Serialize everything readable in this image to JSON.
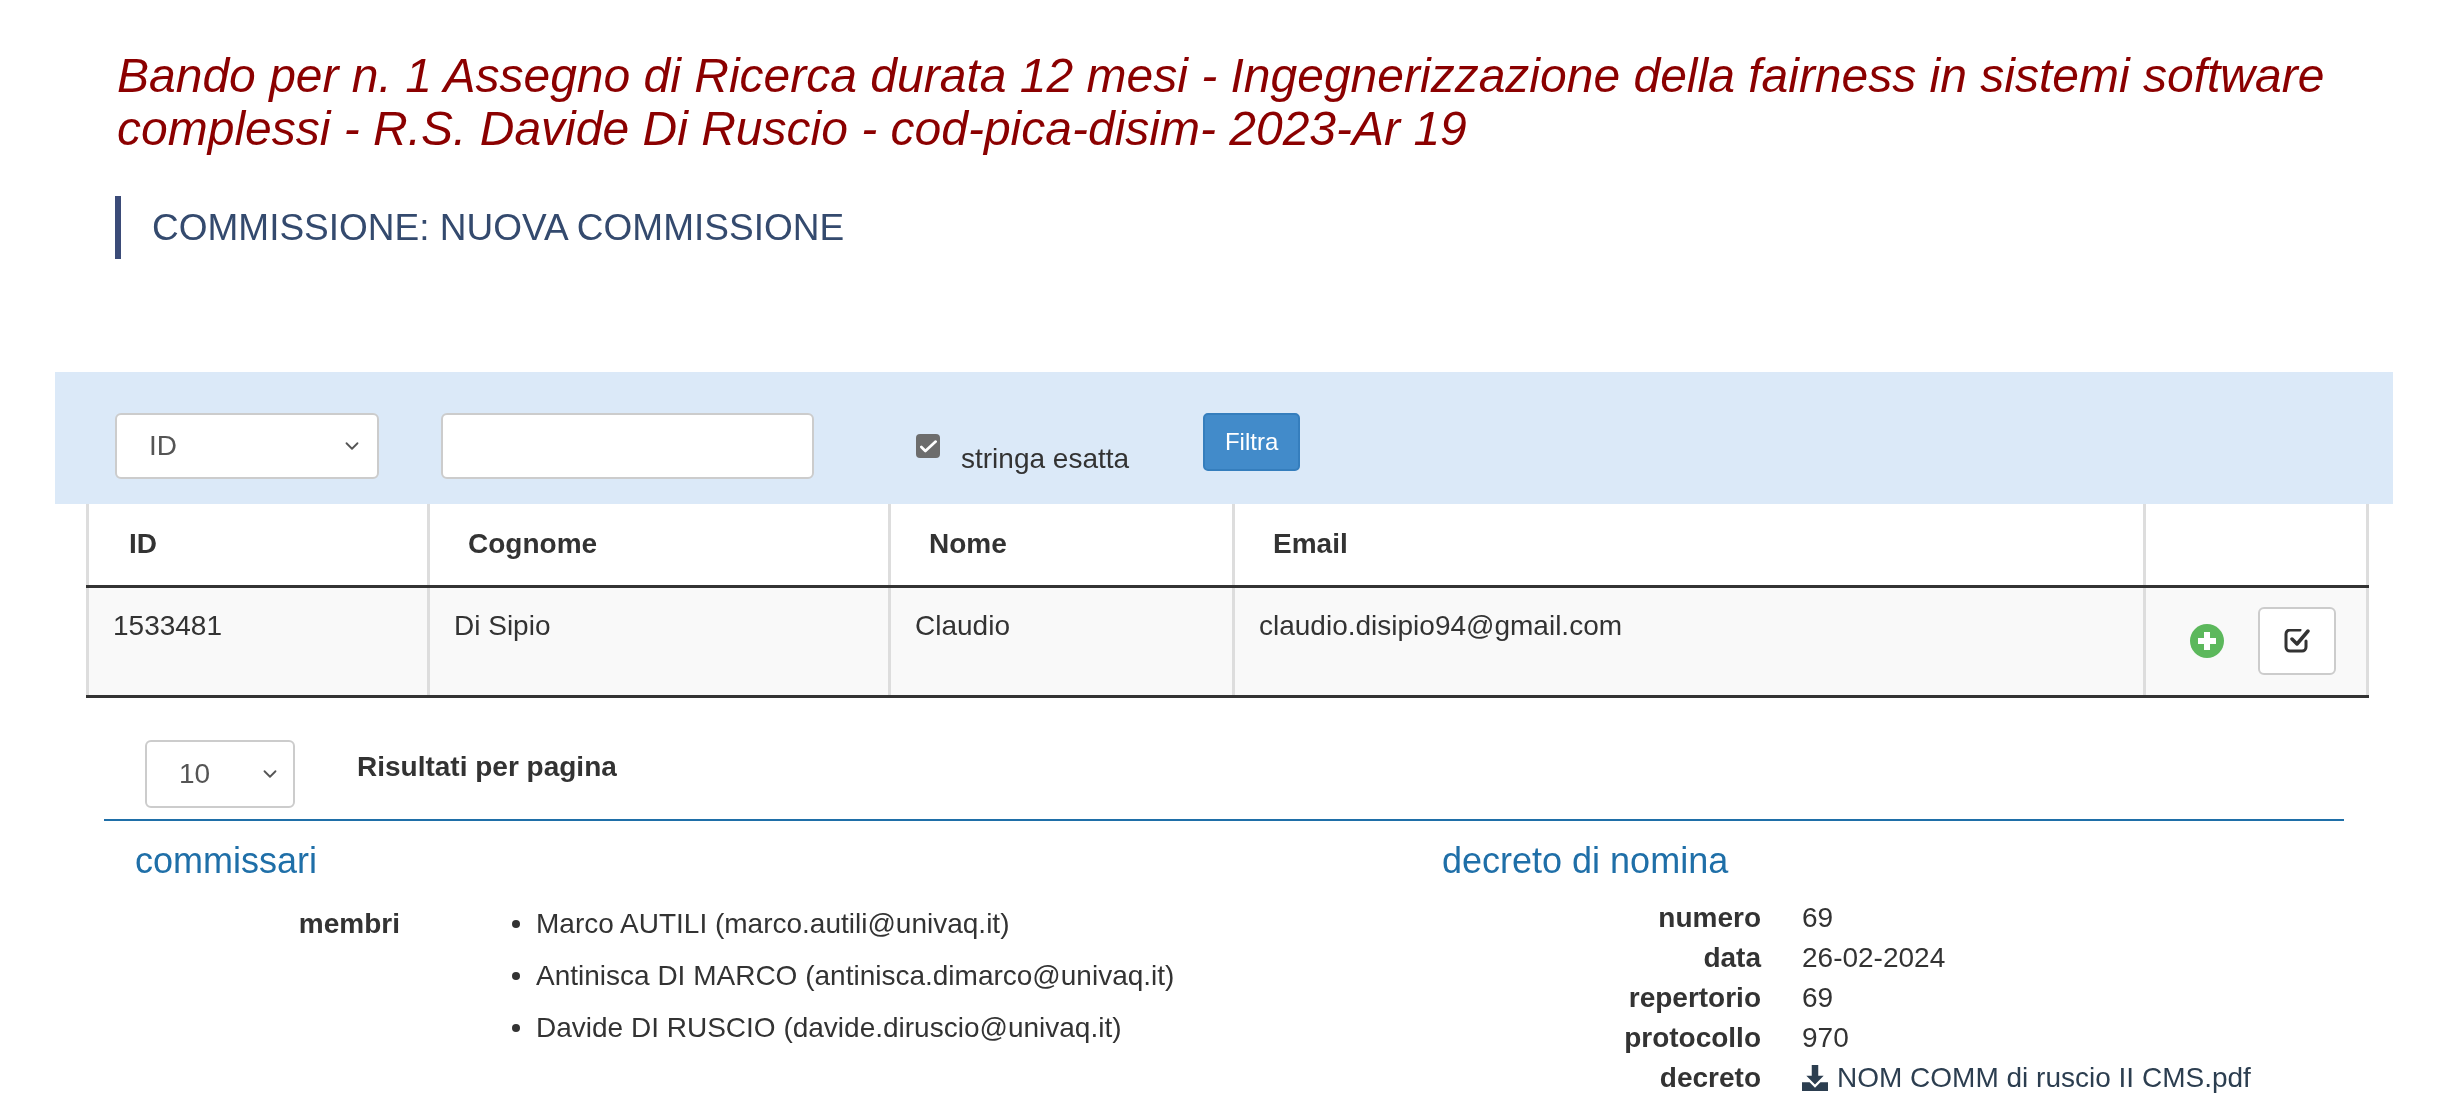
{
  "page_title": "Bando per n. 1 Assegno di Ricerca durata 12 mesi - Ingegnerizzazione della fairness in sistemi software complessi - R.S. Davide Di Ruscio - cod-pica-disim- 2023-Ar 19",
  "section_heading": "COMMISSIONE: NUOVA COMMISSIONE",
  "filter": {
    "field_select": "ID",
    "exact_match": {
      "label": "stringa esatta",
      "checked": true
    },
    "button": "Filtra"
  },
  "table": {
    "columns": [
      "ID",
      "Cognome",
      "Nome",
      "Email"
    ],
    "rows": [
      {
        "cells": [
          "1533481",
          "Di Sipio",
          "Claudio",
          "claudio.disipio94@gmail.com"
        ]
      }
    ]
  },
  "page_size": {
    "value": "10",
    "label": "Risultati per pagina"
  },
  "commissari": {
    "title": "commissari",
    "label": "membri",
    "members": [
      "Marco AUTILI (marco.autili@univaq.it)",
      "Antinisca DI MARCO (antinisca.dimarco@univaq.it)",
      "Davide DI RUSCIO (davide.diruscio@univaq.it)"
    ]
  },
  "decreto": {
    "title": "decreto di nomina",
    "fields": [
      {
        "kind": "text",
        "label": "numero",
        "value": "69"
      },
      {
        "kind": "text",
        "label": "data",
        "value": "26-02-2024"
      },
      {
        "kind": "text",
        "label": "repertorio",
        "value": "69"
      },
      {
        "kind": "text",
        "label": "protocollo",
        "value": "970"
      },
      {
        "kind": "file",
        "label": "decreto",
        "value": "NOM COMM di ruscio II CMS.pdf"
      }
    ]
  }
}
